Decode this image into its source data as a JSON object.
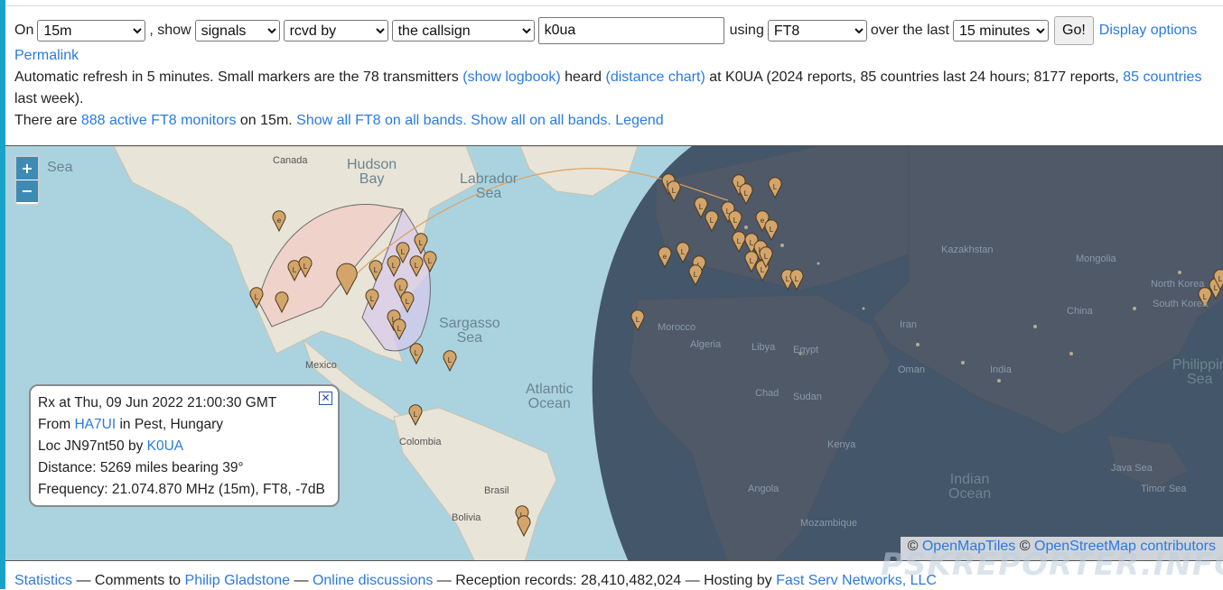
{
  "controls": {
    "on_label": "On",
    "band": "15m",
    "show_label": ", show",
    "show_what": "signals",
    "direction": "rcvd by",
    "target_type": "the callsign",
    "callsign": "k0ua",
    "using_label": "using",
    "mode": "FT8",
    "over_label": "over the last",
    "window": "15 minutes",
    "go_label": "Go!",
    "display_options": "Display options",
    "permalink": "Permalink"
  },
  "info": {
    "t1": "Automatic refresh in 5 minutes. Small markers are the 78 transmitters",
    "show_logbook": "(show logbook)",
    "t2": "heard",
    "distance_chart": "(distance chart)",
    "t3": "at K0UA (2024 reports, 85 countries last 24 hours; 8177 reports,",
    "countries_link": "85 countries",
    "t4": "last week).",
    "t5": "There are",
    "monitors_link": "888 active FT8 monitors",
    "t6": "on 15m.",
    "show_ft8_all": "Show all FT8 on all bands.",
    "show_all_all": "Show all on all bands.",
    "legend": "Legend"
  },
  "map": {
    "zoom_in": "+",
    "zoom_out": "−",
    "labels": {
      "sea_nw": "Sea",
      "hudson": "Hudson\nBay",
      "labrador": "Labrador\nSea",
      "sargasso": "Sargasso\nSea",
      "atlantic": "Atlantic\nOcean",
      "indian": "Indian\nOcean",
      "philippine": "Philippin\nSea",
      "canada": "Canada",
      "mexico": "Mexico",
      "colombia": "Colombia",
      "brazil": "Brasil",
      "bolivia": "Bolivia",
      "morocco": "Morocco",
      "algeria": "Algeria",
      "libya": "Libya",
      "egypt": "Egypt",
      "chad": "Chad",
      "sudan": "Sudan",
      "kazakhstan": "Kazakhstan",
      "mongolia": "Mongolia",
      "china": "China",
      "india": "India",
      "iran": "Iran",
      "north_korea": "North Korea",
      "south_korea": "South Korea",
      "java_sea": "Java Sea",
      "timor_sea": "Timor Sea",
      "mozambique": "Mozambique",
      "kenya": "Kenya",
      "angola": "Angola",
      "oman": "Oman"
    },
    "popup": {
      "line1": "Rx at Thu, 09 Jun 2022 21:00:30 GMT",
      "from_label": "From",
      "from_call": "HA7UI",
      "from_loc": "in Pest, Hungary",
      "loc_label": "Loc JN97nt50 by",
      "loc_call": "K0UA",
      "distance": "Distance: 5269 miles bearing 39°",
      "frequency": "Frequency: 21.074.870 MHz (15m), FT8, -7dB",
      "close": "✕"
    },
    "attribution": {
      "copy1": "©",
      "omt": "OpenMapTiles",
      "copy2": "©",
      "osm": "OpenStreetMap contributors"
    },
    "marker_letters": [
      "L",
      "e"
    ]
  },
  "footer": {
    "statistics": "Statistics",
    "t1": "— Comments to",
    "philip": "Philip Gladstone",
    "sep": "—",
    "online": "Online discussions",
    "t2": "— Reception records: 28,410,482,024 — Hosting by",
    "fastserv": "Fast Serv Networks, LLC"
  },
  "watermark": "PSKREPORTER.INFO",
  "colors": {
    "ocean": "#aad3df",
    "land": "#e8e4d8",
    "night": "#2d3a4f",
    "marker": "#d4a56a",
    "link": "#2a7ae2"
  }
}
